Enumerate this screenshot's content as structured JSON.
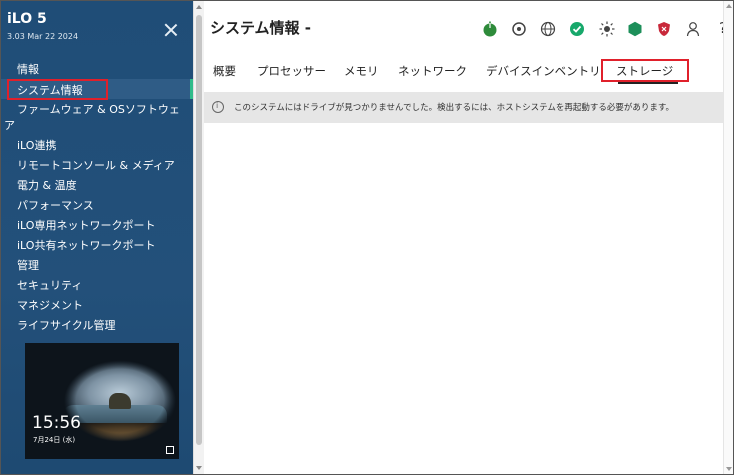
{
  "sidebar": {
    "brand": "iLO 5",
    "version": "3.03 Mar 22 2024",
    "items": [
      {
        "label": "情報"
      },
      {
        "label": "システム情報"
      },
      {
        "label": "ファームウェア & OSソフトウェ"
      },
      {
        "label": "ア"
      },
      {
        "label": "iLO連携"
      },
      {
        "label": "リモートコンソール & メディア"
      },
      {
        "label": "電力 & 温度"
      },
      {
        "label": "パフォーマンス"
      },
      {
        "label": "iLO専用ネットワークポート"
      },
      {
        "label": "iLO共有ネットワークポート"
      },
      {
        "label": "管理"
      },
      {
        "label": "セキュリティ"
      },
      {
        "label": "マネジメント"
      },
      {
        "label": "ライフサイクル管理"
      }
    ],
    "console_preview": {
      "time": "15:56",
      "date": "7月24日 (水)"
    }
  },
  "header": {
    "title": "システム情報 -",
    "icons": [
      "power-icon",
      "locator-icon",
      "globe-icon",
      "health-ok-icon",
      "sun-icon",
      "shield-hex-icon",
      "security-shield-icon",
      "user-icon",
      "help-icon"
    ],
    "help_label": "?"
  },
  "tabs": [
    {
      "label": "概要"
    },
    {
      "label": "プロセッサー"
    },
    {
      "label": "メモリ"
    },
    {
      "label": "ネットワーク"
    },
    {
      "label": "デバイスインベントリ"
    },
    {
      "label": "ストレージ"
    }
  ],
  "active_tab": "ストレージ",
  "banner": {
    "message": "このシステムにはドライブが見つかりませんでした。検出するには、ホストシステムを再起動する必要があります。"
  },
  "colors": {
    "sidebar_bg": "#1f4d77",
    "active_marker": "#2fbb8a",
    "highlight_box": "#e0202b",
    "power_green": "#2e8b3a",
    "ok_green": "#17a86b",
    "red_shield": "#c8283a"
  }
}
